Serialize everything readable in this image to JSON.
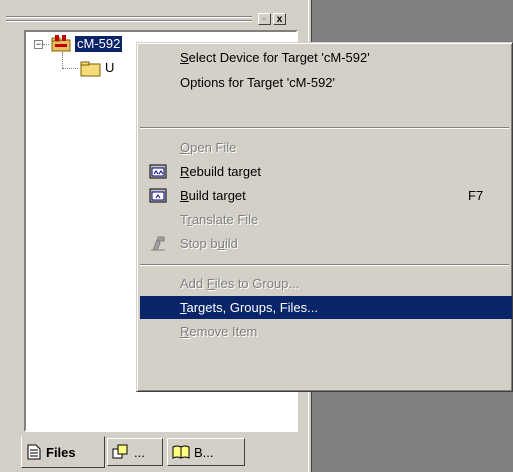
{
  "tree": {
    "target_label": "cM-592",
    "child_label": "U"
  },
  "window_buttons": {
    "restore": "▫",
    "close": "x"
  },
  "tabs": [
    {
      "label": "Files"
    },
    {
      "label": "..."
    },
    {
      "label": "B..."
    }
  ],
  "context_menu": {
    "items": [
      {
        "pre": "",
        "mnemonic": "S",
        "post": "elect Device for Target 'cM-592'",
        "shortcut": "",
        "enabled": true
      },
      {
        "pre": "Options for Target 'cM-592'",
        "mnemonic": "",
        "post": "",
        "shortcut": "",
        "enabled": true
      },
      {
        "pre": "",
        "mnemonic": "O",
        "post": "pen File",
        "shortcut": "",
        "enabled": false
      },
      {
        "pre": "",
        "mnemonic": "R",
        "post": "ebuild target",
        "shortcut": "",
        "enabled": true,
        "icon": "rebuild-icon"
      },
      {
        "pre": "",
        "mnemonic": "B",
        "post": "uild target",
        "shortcut": "F7",
        "enabled": true,
        "icon": "build-icon"
      },
      {
        "pre": "T",
        "mnemonic": "r",
        "post": "anslate File",
        "shortcut": "",
        "enabled": false
      },
      {
        "pre": "Stop b",
        "mnemonic": "u",
        "post": "ild",
        "shortcut": "",
        "enabled": false,
        "icon": "stop-build-icon"
      },
      {
        "pre": "Add ",
        "mnemonic": "F",
        "post": "iles to Group...",
        "shortcut": "",
        "enabled": false
      },
      {
        "pre": "",
        "mnemonic": "T",
        "post": "argets, Groups, Files...",
        "shortcut": "",
        "enabled": true,
        "highlighted": true
      },
      {
        "pre": "",
        "mnemonic": "R",
        "post": "emove Item",
        "shortcut": "",
        "enabled": false
      }
    ]
  },
  "colors": {
    "highlight": "#0a246a",
    "face": "#d4d0c8",
    "workspace": "#808080"
  }
}
